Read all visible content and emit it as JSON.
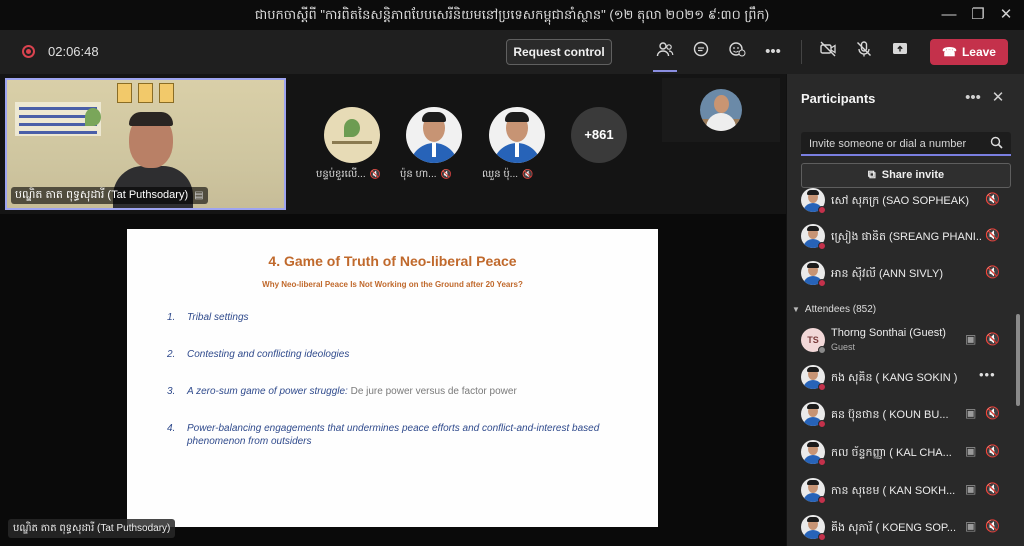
{
  "window": {
    "title": "ជាបកចាស្តីពី \"ការពិតនៃសន្តិភាពបែបសេរីនិយមនៅប្រទេសកម្ពុជានាំស្ថាន\" (១២ តុលា ២០២១ ៩:៣០ ព្រឹក)",
    "minimize_icon": "minimize-icon",
    "maximize_icon": "restore-icon",
    "close_icon": "close-icon"
  },
  "toolbar": {
    "recording_time": "02:06:48",
    "request_control_label": "Request control",
    "icons": [
      "participants-icon",
      "chat-icon",
      "reactions-icon",
      "more-icon",
      "camera-off-icon",
      "mic-off-icon",
      "share-tray-icon"
    ],
    "leave_label": "Leave",
    "leave_color": "#c4314b",
    "active_tab_color": "#8a8ee0"
  },
  "gallery": {
    "presenter_name": "បណ្ឌិត តាត ពុទ្ធសុដារី (Tat Puthsodary)",
    "tiles": [
      {
        "name": "បន្ទប់ខួរលើ...",
        "avatar": "org-logo"
      },
      {
        "name": "ប៉ុន ហា...",
        "avatar": "person"
      },
      {
        "name": "ឈួន ប៉ុ...",
        "avatar": "person"
      }
    ],
    "overflow_count": "+861"
  },
  "slide": {
    "title": "4. Game of Truth of Neo-liberal Peace",
    "subtitle": "Why Neo-liberal Peace Is Not Working on the Ground after 20 Years?",
    "items": [
      {
        "num": "1.",
        "text": "Tribal settings"
      },
      {
        "num": "2.",
        "text": "Contesting and conflicting ideologies"
      },
      {
        "num": "3.",
        "text": "A zero-sum game of power struggle:",
        "extra": " De jure power versus de factor power"
      },
      {
        "num": "4.",
        "text": "Power-balancing engagements that undermines peace efforts and conflict-and-interest based phenomenon from outsiders"
      }
    ],
    "presenter_tag": "បណ្ឌិត តាត ពុទ្ធសុដារី (Tat Puthsodary)"
  },
  "participants": {
    "title": "Participants",
    "invite_placeholder": "Invite someone or dial a number",
    "share_invite_label": "Share invite",
    "presenters": [
      {
        "name": "សៅ សុភក្រ (SAO SOPHEAK)"
      },
      {
        "name": "ស្រៀង ផានិត (SREANG PHANI..."
      },
      {
        "name": "អាន ស៊ីវលី (ANN SIVLY)"
      }
    ],
    "attendees_label": "Attendees (852)",
    "attendees": [
      {
        "name": "Thorng Sonthai (Guest)",
        "role": "Guest",
        "initials": "TS"
      },
      {
        "name": "កង សុគិន ( KANG SOKIN )"
      },
      {
        "name": "គន ប៊ុនថាន ( KOUN BU..."
      },
      {
        "name": "កល ច័ន្ទកញ្ញា ( KAL CHA..."
      },
      {
        "name": "កាន សុខេម ( KAN SOKH..."
      },
      {
        "name": "គឹង សុភារី ( KOENG SOP..."
      }
    ]
  }
}
